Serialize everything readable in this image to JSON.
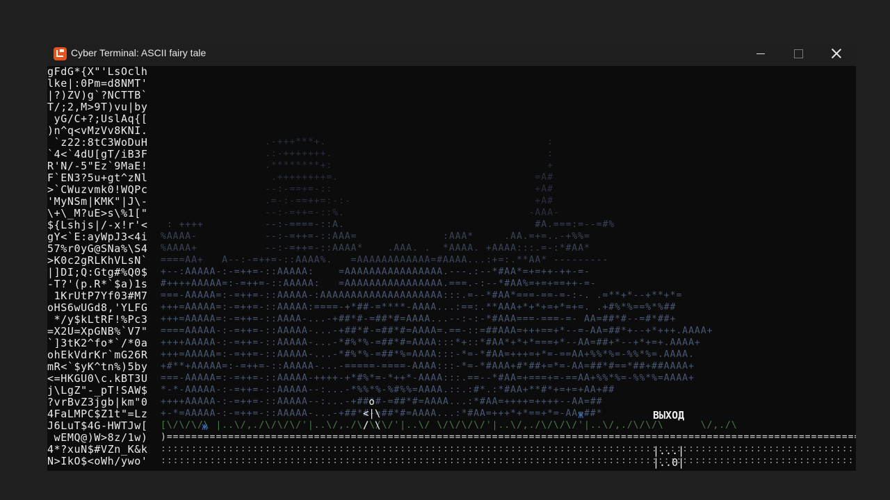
{
  "window": {
    "title": "Cyber Terminal: ASCII fairy tale",
    "icon": "app-logo-icon",
    "controls": {
      "minimize_icon": "minimize-icon",
      "maximize_icon": "maximize-icon",
      "close_icon": "close-icon"
    }
  },
  "terminal": {
    "left_stream": [
      "gFdG*{X\"'LsOclh",
      "lke|:0Pm=d8NMT'",
      "|?)ZV)g`?NCTTB`",
      "T/;2,M>9T)vu|by",
      " yG/C+?;UslAq{[",
      ")n^q<vMzVv8KNI.",
      " `z22:8tC3WoDuH",
      "`4<`4dU[gT/iB3F",
      "R'N/-5\"Ez`9MaE!",
      "F`EN3?5u+gt^zNl",
      ">`CWuzvmk0!WQPc",
      "'MyNSm|KMK\"|J\\-",
      "\\+\\_M?uE>s\\%1[\"",
      "${Lshjs|/-x!r'<",
      "gY<`E:ayWpJ3<4i",
      "57%r0yG@SNa%\\S4",
      ">K0c2gRLKhVLsN`",
      "|]DI;Q:Gtg#%Q0$",
      "-T?'(p.R*`$a)1s",
      " 1KrUtP7Yf03#M7",
      "oHS6wUGd8,'YLFG",
      " */y$kLtRF!%Pc3",
      "=X2U=XpGNB%`V7\"",
      "`]3tK2^fo*`/*0a",
      "ohEkVdrKr`mG26R",
      "mR<`$yK^tn%)5by",
      "<=HKGU0\\c.kBT3U",
      "j\\LgZ\"-_pT!SAW$",
      "?vrBvZ3jgb|km\"0",
      "4FaLMPC$Z1t\"=Lz",
      "J6LuT$4G-HWTJw[",
      " wEMQ@)W>8z/1w)",
      "4*?xuN$#VZn_K&k",
      "N>IkO$<oWh/ywo'"
    ],
    "exit_label": "ВЫХОД",
    "exit_door": [
      "|...|",
      "|..0|",
      "|...|"
    ],
    "hero_sprite": [
      " o",
      "<|\\",
      "/ \\"
    ],
    "bug_glyph": "ж",
    "rail_char": "=",
    "floor_char": ":"
  },
  "colors": {
    "window_bg": "#0c0c0c",
    "titlebar_bg": "#1f1f1f",
    "accent_icon": "#e8521c",
    "ground": "#4a7d4a",
    "bug": "#3d6fb8"
  }
}
